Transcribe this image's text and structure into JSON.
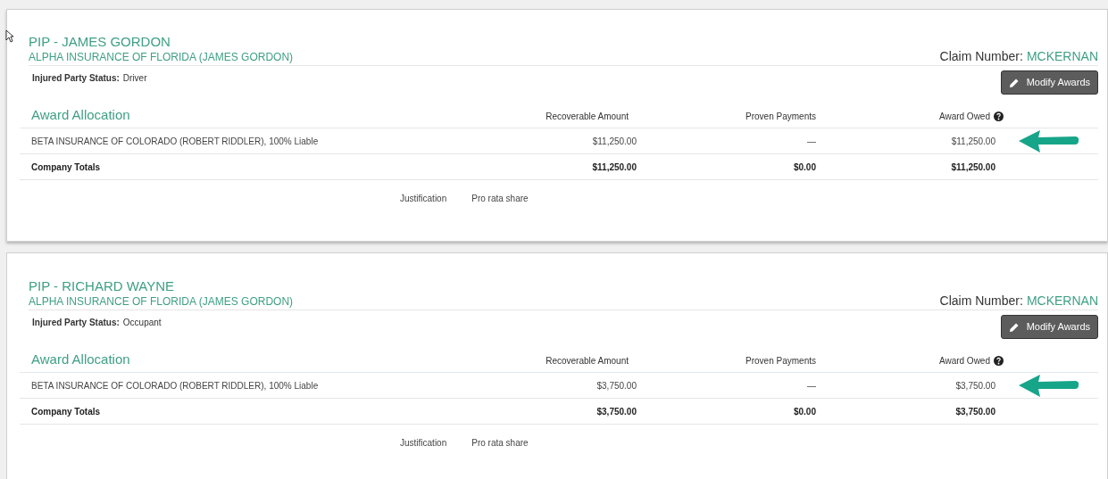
{
  "cards": [
    {
      "title": "PIP - JAMES GORDON",
      "company": "ALPHA INSURANCE OF FLORIDA (JAMES GORDON)",
      "claim_label": "Claim Number:",
      "claim_value": "MCKERNAN",
      "status_label": "Injured Party Status:",
      "status_value": "Driver",
      "button": "Modify Awards",
      "section": "Award Allocation",
      "columns": [
        "Recoverable Amount",
        "Proven Payments",
        "Award Owed"
      ],
      "rows": [
        {
          "kind": "item",
          "name": "BETA INSURANCE OF COLORADO (ROBERT RIDDLER), 100% Liable",
          "recoverable": "$11,250.00",
          "proven": "—",
          "owed": "$11,250.00"
        },
        {
          "kind": "total",
          "name": "Company Totals",
          "recoverable": "$11,250.00",
          "proven": "$0.00",
          "owed": "$11,250.00"
        }
      ],
      "justification_label": "Justification",
      "justification_value": "Pro rata share"
    },
    {
      "title": "PIP - RICHARD WAYNE",
      "company": "ALPHA INSURANCE OF FLORIDA (JAMES GORDON)",
      "claim_label": "Claim Number:",
      "claim_value": "MCKERNAN",
      "status_label": "Injured Party Status:",
      "status_value": "Occupant",
      "button": "Modify Awards",
      "section": "Award Allocation",
      "columns": [
        "Recoverable Amount",
        "Proven Payments",
        "Award Owed"
      ],
      "rows": [
        {
          "kind": "item",
          "name": "BETA INSURANCE OF COLORADO (ROBERT RIDDLER), 100% Liable",
          "recoverable": "$3,750.00",
          "proven": "—",
          "owed": "$3,750.00"
        },
        {
          "kind": "total",
          "name": "Company Totals",
          "recoverable": "$3,750.00",
          "proven": "$0.00",
          "owed": "$3,750.00"
        }
      ],
      "justification_label": "Justification",
      "justification_value": "Pro rata share"
    }
  ]
}
